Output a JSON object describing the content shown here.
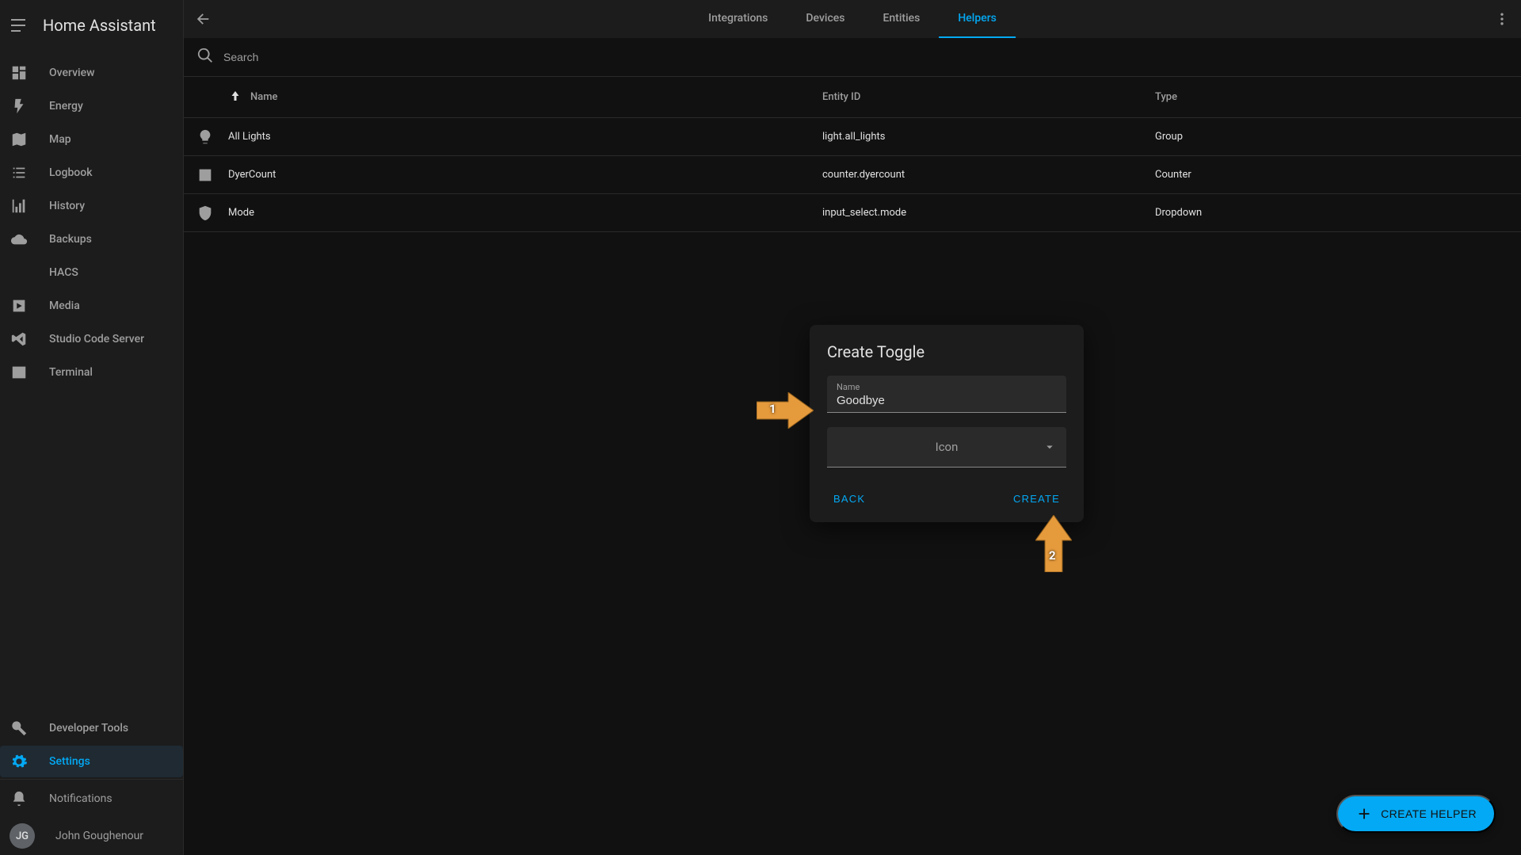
{
  "app_title": "Home Assistant",
  "sidebar": {
    "items": [
      {
        "icon": "dashboard",
        "label": "Overview"
      },
      {
        "icon": "flash",
        "label": "Energy"
      },
      {
        "icon": "map",
        "label": "Map"
      },
      {
        "icon": "list",
        "label": "Logbook"
      },
      {
        "icon": "chart",
        "label": "History"
      },
      {
        "icon": "cloud",
        "label": "Backups"
      },
      {
        "icon": "none",
        "label": "HACS"
      },
      {
        "icon": "play",
        "label": "Media"
      },
      {
        "icon": "vscode",
        "label": "Studio Code Server"
      },
      {
        "icon": "terminal",
        "label": "Terminal"
      }
    ],
    "bottom": [
      {
        "icon": "wrench",
        "label": "Developer Tools",
        "active": false
      },
      {
        "icon": "cog",
        "label": "Settings",
        "active": true
      }
    ],
    "notifications_label": "Notifications",
    "user": {
      "initials": "JG",
      "name": "John Goughenour"
    }
  },
  "tabs": [
    {
      "label": "Integrations",
      "active": false
    },
    {
      "label": "Devices",
      "active": false
    },
    {
      "label": "Entities",
      "active": false
    },
    {
      "label": "Helpers",
      "active": true
    }
  ],
  "search_placeholder": "Search",
  "table": {
    "columns": {
      "name": "Name",
      "entity": "Entity ID",
      "type": "Type"
    },
    "rows": [
      {
        "icon": "lightbulb",
        "name": "All Lights",
        "entity": "light.all_lights",
        "type": "Group"
      },
      {
        "icon": "counter",
        "name": "DyerCount",
        "entity": "counter.dyercount",
        "type": "Counter"
      },
      {
        "icon": "shield",
        "name": "Mode",
        "entity": "input_select.mode",
        "type": "Dropdown"
      }
    ]
  },
  "fab_label": "CREATE HELPER",
  "dialog": {
    "title": "Create Toggle",
    "name_label": "Name",
    "name_value": "Goodbye",
    "icon_label": "Icon",
    "back": "BACK",
    "create": "CREATE"
  },
  "annotations": {
    "arrow1": "1",
    "arrow2": "2"
  }
}
